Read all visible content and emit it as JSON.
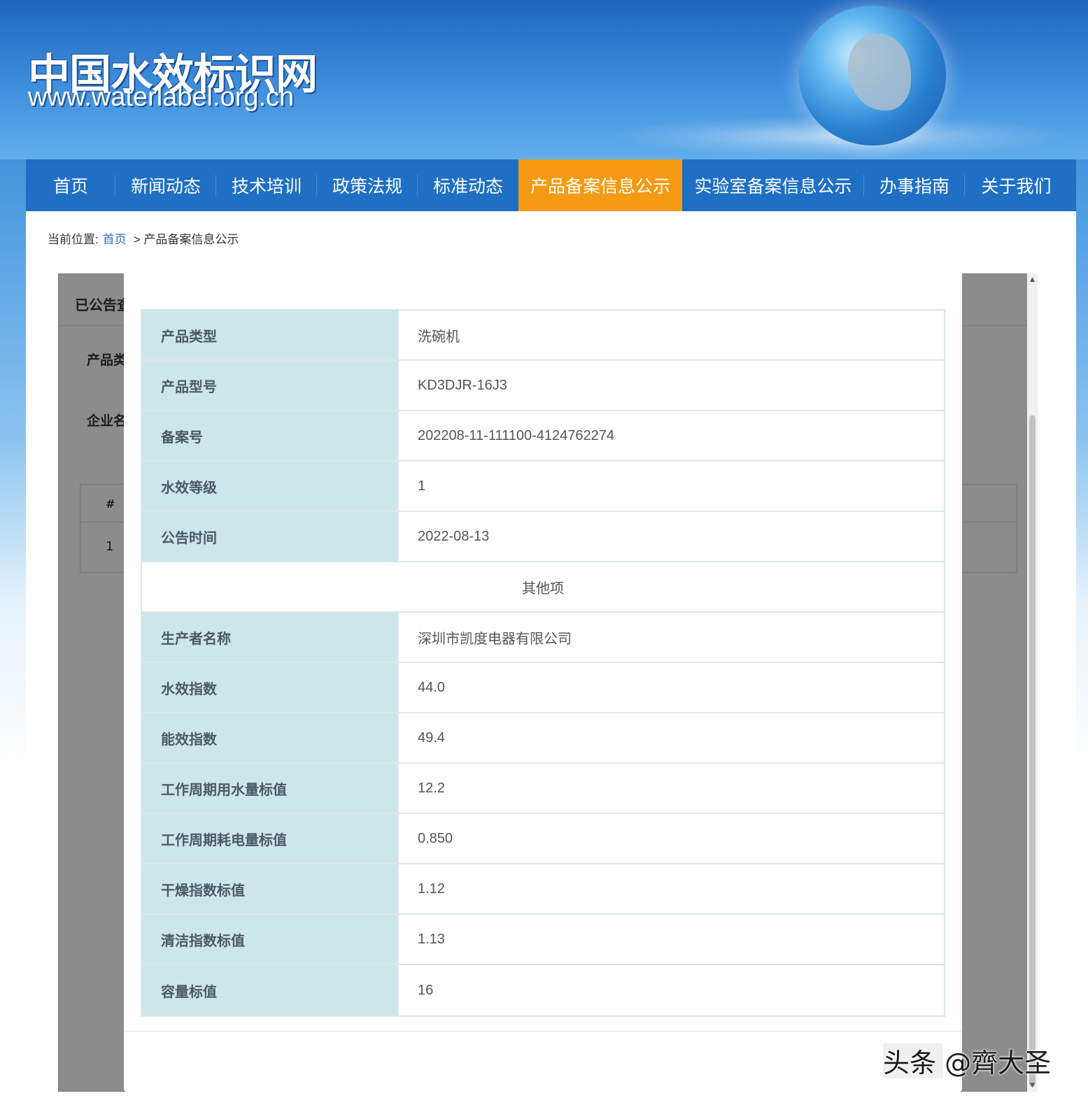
{
  "header": {
    "site_name": "中国水效标识网",
    "site_url": "www.waterlabel.org.cn"
  },
  "nav": {
    "items": [
      {
        "label": "首页",
        "active": false
      },
      {
        "label": "新闻动态",
        "active": false
      },
      {
        "label": "技术培训",
        "active": false
      },
      {
        "label": "政策法规",
        "active": false
      },
      {
        "label": "标准动态",
        "active": false
      },
      {
        "label": "产品备案信息公示",
        "active": true
      },
      {
        "label": "实验室备案信息公示",
        "active": false
      },
      {
        "label": "办事指南",
        "active": false
      },
      {
        "label": "关于我们",
        "active": false
      }
    ],
    "active_color": "#f59a12",
    "bar_color": "#1f6fc4"
  },
  "breadcrumb": {
    "prefix": "当前位置:",
    "home": "首页",
    "separator": ">",
    "current": "产品备案信息公示"
  },
  "background_panel": {
    "header": "已公告查",
    "label_1": "产品类",
    "label_2": "企业名",
    "table_header": "#",
    "table_row_index": "1"
  },
  "modal": {
    "rows_main": [
      {
        "key": "产品类型",
        "value": "洗碗机"
      },
      {
        "key": "产品型号",
        "value": "KD3DJR-16J3"
      },
      {
        "key": "备案号",
        "value": "202208-11-111100-4124762274"
      },
      {
        "key": "水效等级",
        "value": "1"
      },
      {
        "key": "公告时间",
        "value": "2022-08-13"
      }
    ],
    "section_title": "其他项",
    "rows_other": [
      {
        "key": "生产者名称",
        "value": "深圳市凯度电器有限公司"
      },
      {
        "key": "水效指数",
        "value": "44.0"
      },
      {
        "key": "能效指数",
        "value": "49.4"
      },
      {
        "key": "工作周期用水量标值",
        "value": "12.2"
      },
      {
        "key": "工作周期耗电量标值",
        "value": "0.850"
      },
      {
        "key": "干燥指数标值",
        "value": "1.12"
      },
      {
        "key": "清洁指数标值",
        "value": "1.13"
      },
      {
        "key": "容量标值",
        "value": "16"
      }
    ],
    "key_bg_color": "#cde6ea"
  },
  "watermark": {
    "text": "头条 @齊大圣"
  }
}
